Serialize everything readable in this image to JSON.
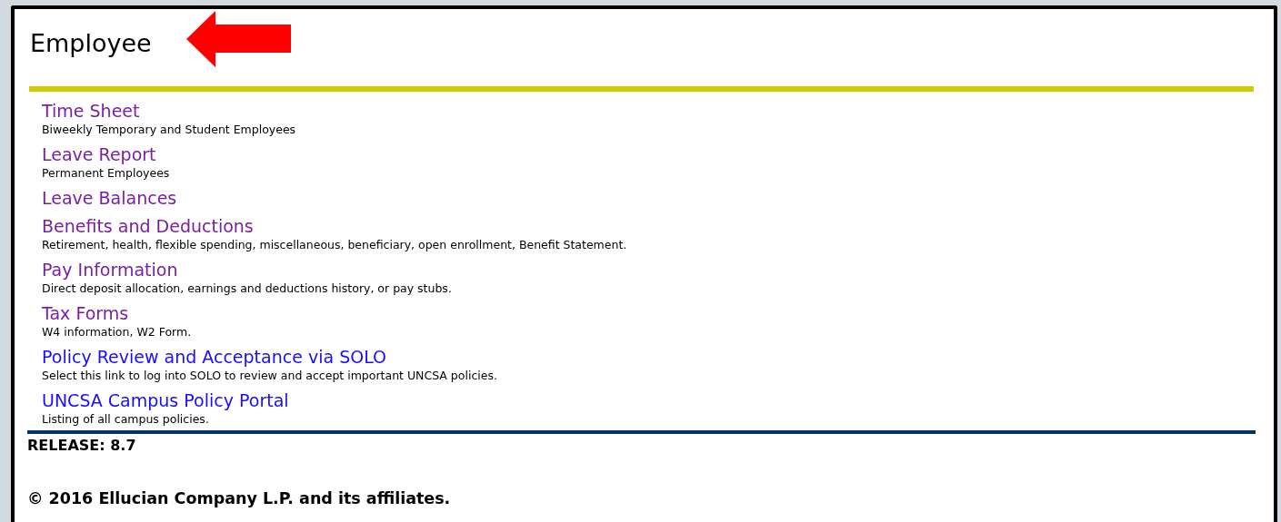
{
  "page": {
    "title": "Employee"
  },
  "links": [
    {
      "label": "Time Sheet",
      "visited": true,
      "description": "Biweekly Temporary and Student Employees"
    },
    {
      "label": "Leave Report",
      "visited": true,
      "description": "Permanent Employees"
    },
    {
      "label": "Leave Balances",
      "visited": true
    },
    {
      "label": "Benefits and Deductions",
      "visited": true,
      "description": "Retirement, health, flexible spending, miscellaneous, beneficiary, open enrollment, Benefit Statement."
    },
    {
      "label": "Pay Information",
      "visited": true,
      "description": "Direct deposit allocation, earnings and deductions history, or pay stubs."
    },
    {
      "label": "Tax Forms",
      "visited": true,
      "description": "W4 information, W2 Form."
    },
    {
      "label": "Policy Review and Acceptance via SOLO",
      "visited": false,
      "description": "Select this link to log into SOLO to review and accept important UNCSA policies."
    },
    {
      "label": "UNCSA Campus Policy Portal",
      "visited": false,
      "description": "Listing of all campus policies."
    }
  ],
  "footer": {
    "release": "RELEASE: 8.7",
    "copyright": "© 2016 Ellucian Company L.P. and its affiliates."
  }
}
